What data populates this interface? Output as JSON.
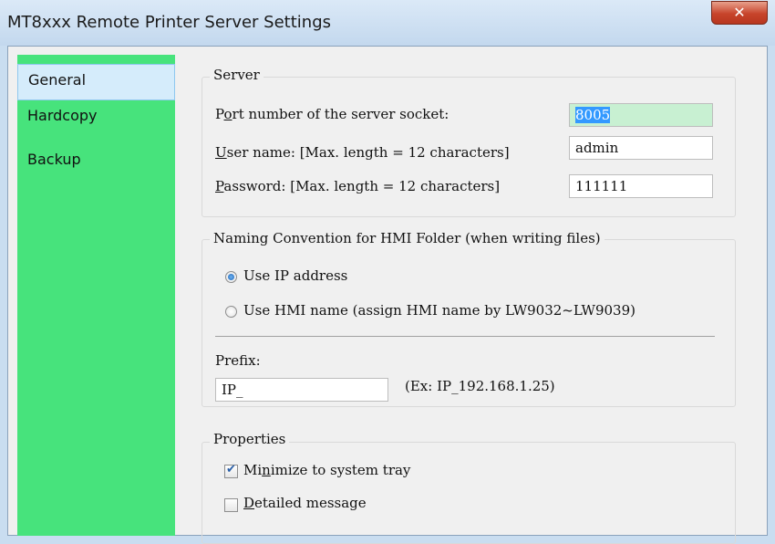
{
  "window": {
    "title": "MT8xxx Remote Printer Server Settings",
    "close_icon": "close-icon"
  },
  "sidebar": {
    "items": [
      {
        "label": "General"
      },
      {
        "label": "Hardcopy"
      },
      {
        "label": "Backup"
      }
    ]
  },
  "server": {
    "group_label": "Server",
    "port_label_pre": "P",
    "port_label_ul": "o",
    "port_label_post": "rt number of the server socket:",
    "port_value": "8005",
    "user_label_ul": "U",
    "user_label_post": "ser name: [Max. length = 12 characters]",
    "user_value": "admin",
    "password_label_ul": "P",
    "password_label_post": "assword: [Max. length = 12 characters]",
    "password_value": "111111"
  },
  "naming": {
    "group_label": "Naming Convention for HMI Folder (when writing files)",
    "option_ip": "Use IP address",
    "option_hmi": "Use HMI name (assign HMI name by LW9032~LW9039)",
    "prefix_label": "Prefix:",
    "prefix_value": "IP_",
    "prefix_example": "(Ex: IP_192.168.1.25)"
  },
  "properties": {
    "group_label": "Properties",
    "minimize_pre": "Mi",
    "minimize_ul": "n",
    "minimize_post": "imize to system tray",
    "detailed_ul": "D",
    "detailed_post": "etailed message"
  }
}
